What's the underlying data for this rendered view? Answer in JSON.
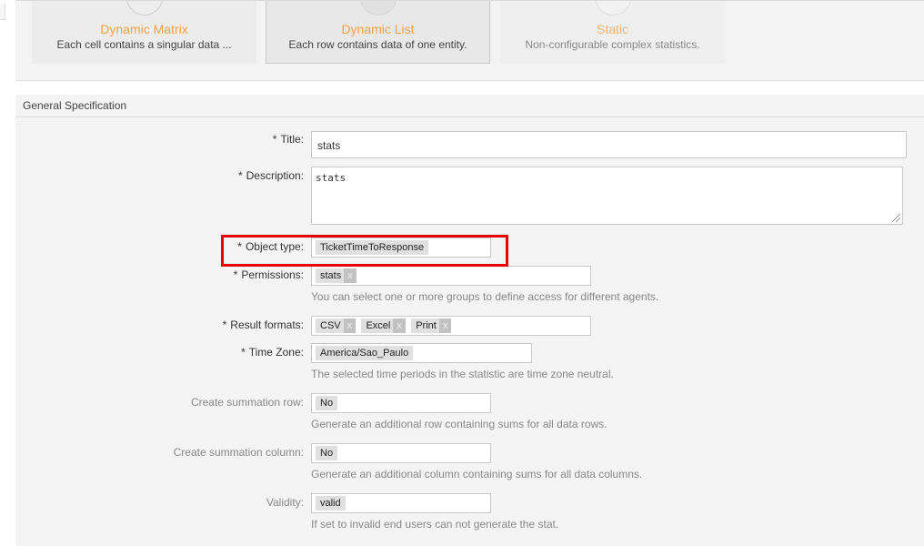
{
  "stat_types": [
    {
      "title": "Dynamic Matrix",
      "description": "Each cell contains a singular data ...",
      "selected": false
    },
    {
      "title": "Dynamic List",
      "description": "Each row contains data of one entity.",
      "selected": true
    },
    {
      "title": "Static",
      "description": "Non-configurable complex statistics.",
      "selected": false
    }
  ],
  "accent_color": "#f7a24d",
  "highlight_color": "#e60000",
  "general_spec": {
    "header": "General Specification",
    "required_marker": "*",
    "title": {
      "label": "Title:",
      "value": "stats"
    },
    "description": {
      "label": "Description:",
      "value": "stats"
    },
    "object_type": {
      "label": "Object type:",
      "value": "TicketTimeToResponse"
    },
    "permissions": {
      "label": "Permissions:",
      "chips": [
        "stats"
      ],
      "remove_glyph": "x",
      "help": "You can select one or more groups to define access for different agents."
    },
    "result_formats": {
      "label": "Result formats:",
      "chips": [
        "CSV",
        "Excel",
        "Print"
      ],
      "remove_glyph": "x"
    },
    "time_zone": {
      "label": "Time Zone:",
      "value": "America/Sao_Paulo",
      "help": "The selected time periods in the statistic are time zone neutral."
    },
    "sum_row": {
      "label": "Create summation row:",
      "value": "No",
      "help": "Generate an additional row containing sums for all data rows."
    },
    "sum_col": {
      "label": "Create summation column:",
      "value": "No",
      "help": "Generate an additional column containing sums for all data columns."
    },
    "validity": {
      "label": "Validity:",
      "value": "valid",
      "help": "If set to invalid end users can not generate the stat."
    }
  }
}
